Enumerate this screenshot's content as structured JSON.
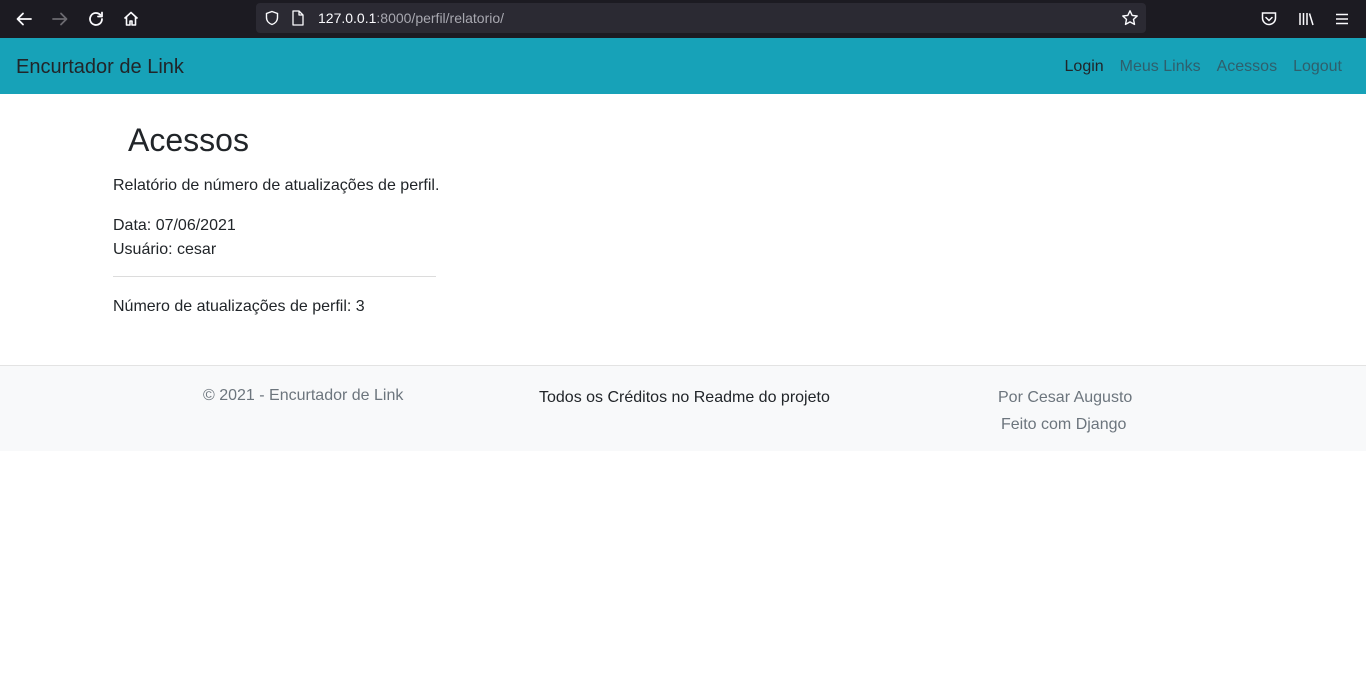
{
  "browser": {
    "url_host": "127.0.0.1",
    "url_rest": ":8000/perfil/relatorio/"
  },
  "navbar": {
    "brand": "Encurtador de Link",
    "links": [
      {
        "label": "Login"
      },
      {
        "label": "Meus Links"
      },
      {
        "label": "Acessos"
      },
      {
        "label": "Logout"
      }
    ]
  },
  "main": {
    "title": "Acessos",
    "description": "Relatório de número de atualizações de perfil.",
    "date": "Data: 07/06/2021",
    "user": "Usuário: cesar",
    "count": "Número de atualizações de perfil: 3"
  },
  "footer": {
    "copyright": "© 2021 - Encurtador de Link",
    "credits": "Todos os Créditos no Readme do projeto",
    "author": "Por Cesar Augusto",
    "made_with": "Feito com Django"
  },
  "colors": {
    "navbar_bg": "#17a2b8",
    "footer_bg": "#f8f9fa"
  }
}
